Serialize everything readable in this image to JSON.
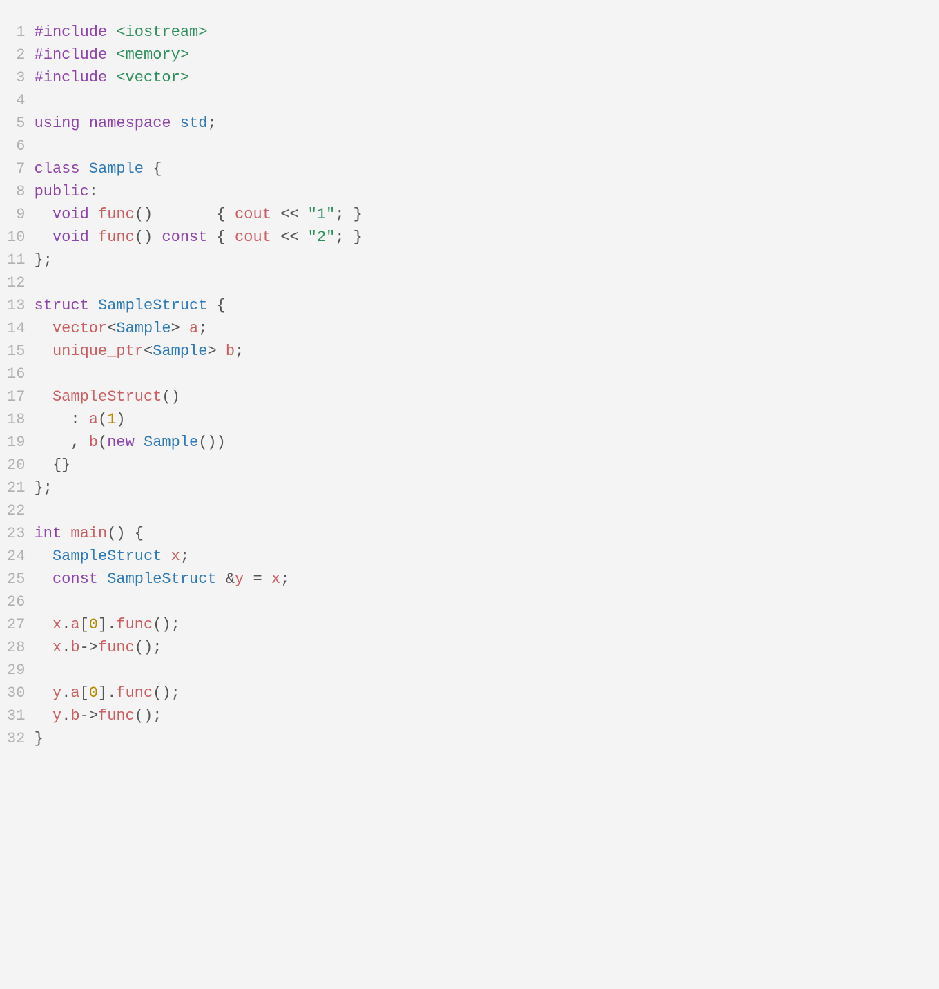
{
  "language": "cpp",
  "colors": {
    "background": "#f4f4f4",
    "gutter": "#b0b0b0",
    "keyword": "#8e44ad",
    "type": "#2e7ab8",
    "func": "#cc5e61",
    "string": "#2f8f5b",
    "number": "#b58900",
    "punct": "#555555",
    "default": "#333333"
  },
  "lines": [
    {
      "n": "1",
      "tokens": [
        {
          "c": "keyword",
          "t": "#include"
        },
        {
          "c": "default",
          "t": " "
        },
        {
          "c": "string",
          "t": "<iostream>"
        }
      ]
    },
    {
      "n": "2",
      "tokens": [
        {
          "c": "keyword",
          "t": "#include"
        },
        {
          "c": "default",
          "t": " "
        },
        {
          "c": "string",
          "t": "<memory>"
        }
      ]
    },
    {
      "n": "3",
      "tokens": [
        {
          "c": "keyword",
          "t": "#include"
        },
        {
          "c": "default",
          "t": " "
        },
        {
          "c": "string",
          "t": "<vector>"
        }
      ]
    },
    {
      "n": "4",
      "tokens": []
    },
    {
      "n": "5",
      "tokens": [
        {
          "c": "keyword",
          "t": "using"
        },
        {
          "c": "default",
          "t": " "
        },
        {
          "c": "keyword",
          "t": "namespace"
        },
        {
          "c": "default",
          "t": " "
        },
        {
          "c": "type",
          "t": "std"
        },
        {
          "c": "punct",
          "t": ";"
        }
      ]
    },
    {
      "n": "6",
      "tokens": []
    },
    {
      "n": "7",
      "tokens": [
        {
          "c": "keyword",
          "t": "class"
        },
        {
          "c": "default",
          "t": " "
        },
        {
          "c": "type",
          "t": "Sample"
        },
        {
          "c": "default",
          "t": " "
        },
        {
          "c": "punct",
          "t": "{"
        }
      ]
    },
    {
      "n": "8",
      "tokens": [
        {
          "c": "keyword",
          "t": "public"
        },
        {
          "c": "punct",
          "t": ":"
        }
      ]
    },
    {
      "n": "9",
      "tokens": [
        {
          "c": "default",
          "t": "  "
        },
        {
          "c": "keyword",
          "t": "void"
        },
        {
          "c": "default",
          "t": " "
        },
        {
          "c": "func",
          "t": "func"
        },
        {
          "c": "punct",
          "t": "()       { "
        },
        {
          "c": "ident",
          "t": "cout"
        },
        {
          "c": "default",
          "t": " "
        },
        {
          "c": "punct",
          "t": "<<"
        },
        {
          "c": "default",
          "t": " "
        },
        {
          "c": "string",
          "t": "\"1\""
        },
        {
          "c": "punct",
          "t": "; }"
        }
      ]
    },
    {
      "n": "10",
      "tokens": [
        {
          "c": "default",
          "t": "  "
        },
        {
          "c": "keyword",
          "t": "void"
        },
        {
          "c": "default",
          "t": " "
        },
        {
          "c": "func",
          "t": "func"
        },
        {
          "c": "punct",
          "t": "() "
        },
        {
          "c": "keyword",
          "t": "const"
        },
        {
          "c": "punct",
          "t": " { "
        },
        {
          "c": "ident",
          "t": "cout"
        },
        {
          "c": "default",
          "t": " "
        },
        {
          "c": "punct",
          "t": "<<"
        },
        {
          "c": "default",
          "t": " "
        },
        {
          "c": "string",
          "t": "\"2\""
        },
        {
          "c": "punct",
          "t": "; }"
        }
      ]
    },
    {
      "n": "11",
      "tokens": [
        {
          "c": "punct",
          "t": "};"
        }
      ]
    },
    {
      "n": "12",
      "tokens": []
    },
    {
      "n": "13",
      "tokens": [
        {
          "c": "keyword",
          "t": "struct"
        },
        {
          "c": "default",
          "t": " "
        },
        {
          "c": "type",
          "t": "SampleStruct"
        },
        {
          "c": "default",
          "t": " "
        },
        {
          "c": "punct",
          "t": "{"
        }
      ]
    },
    {
      "n": "14",
      "tokens": [
        {
          "c": "default",
          "t": "  "
        },
        {
          "c": "ident",
          "t": "vector"
        },
        {
          "c": "punct",
          "t": "<"
        },
        {
          "c": "type",
          "t": "Sample"
        },
        {
          "c": "punct",
          "t": ">"
        },
        {
          "c": "default",
          "t": " "
        },
        {
          "c": "ident",
          "t": "a"
        },
        {
          "c": "punct",
          "t": ";"
        }
      ]
    },
    {
      "n": "15",
      "tokens": [
        {
          "c": "default",
          "t": "  "
        },
        {
          "c": "ident",
          "t": "unique_ptr"
        },
        {
          "c": "punct",
          "t": "<"
        },
        {
          "c": "type",
          "t": "Sample"
        },
        {
          "c": "punct",
          "t": ">"
        },
        {
          "c": "default",
          "t": " "
        },
        {
          "c": "ident",
          "t": "b"
        },
        {
          "c": "punct",
          "t": ";"
        }
      ]
    },
    {
      "n": "16",
      "tokens": []
    },
    {
      "n": "17",
      "tokens": [
        {
          "c": "default",
          "t": "  "
        },
        {
          "c": "func",
          "t": "SampleStruct"
        },
        {
          "c": "punct",
          "t": "()"
        }
      ]
    },
    {
      "n": "18",
      "tokens": [
        {
          "c": "default",
          "t": "    "
        },
        {
          "c": "punct",
          "t": ": "
        },
        {
          "c": "func",
          "t": "a"
        },
        {
          "c": "punct",
          "t": "("
        },
        {
          "c": "number",
          "t": "1"
        },
        {
          "c": "punct",
          "t": ")"
        }
      ]
    },
    {
      "n": "19",
      "tokens": [
        {
          "c": "default",
          "t": "    "
        },
        {
          "c": "punct",
          "t": ", "
        },
        {
          "c": "func",
          "t": "b"
        },
        {
          "c": "punct",
          "t": "("
        },
        {
          "c": "keyword",
          "t": "new"
        },
        {
          "c": "default",
          "t": " "
        },
        {
          "c": "type",
          "t": "Sample"
        },
        {
          "c": "punct",
          "t": "())"
        }
      ]
    },
    {
      "n": "20",
      "tokens": [
        {
          "c": "default",
          "t": "  "
        },
        {
          "c": "punct",
          "t": "{}"
        }
      ]
    },
    {
      "n": "21",
      "tokens": [
        {
          "c": "punct",
          "t": "};"
        }
      ]
    },
    {
      "n": "22",
      "tokens": []
    },
    {
      "n": "23",
      "tokens": [
        {
          "c": "keyword",
          "t": "int"
        },
        {
          "c": "default",
          "t": " "
        },
        {
          "c": "func",
          "t": "main"
        },
        {
          "c": "punct",
          "t": "() {"
        }
      ]
    },
    {
      "n": "24",
      "tokens": [
        {
          "c": "default",
          "t": "  "
        },
        {
          "c": "type",
          "t": "SampleStruct"
        },
        {
          "c": "default",
          "t": " "
        },
        {
          "c": "ident",
          "t": "x"
        },
        {
          "c": "punct",
          "t": ";"
        }
      ]
    },
    {
      "n": "25",
      "tokens": [
        {
          "c": "default",
          "t": "  "
        },
        {
          "c": "keyword",
          "t": "const"
        },
        {
          "c": "default",
          "t": " "
        },
        {
          "c": "type",
          "t": "SampleStruct"
        },
        {
          "c": "default",
          "t": " "
        },
        {
          "c": "punct",
          "t": "&"
        },
        {
          "c": "ident",
          "t": "y"
        },
        {
          "c": "default",
          "t": " "
        },
        {
          "c": "punct",
          "t": "="
        },
        {
          "c": "default",
          "t": " "
        },
        {
          "c": "ident",
          "t": "x"
        },
        {
          "c": "punct",
          "t": ";"
        }
      ]
    },
    {
      "n": "26",
      "tokens": []
    },
    {
      "n": "27",
      "tokens": [
        {
          "c": "default",
          "t": "  "
        },
        {
          "c": "ident",
          "t": "x"
        },
        {
          "c": "punct",
          "t": "."
        },
        {
          "c": "ident",
          "t": "a"
        },
        {
          "c": "punct",
          "t": "["
        },
        {
          "c": "number",
          "t": "0"
        },
        {
          "c": "punct",
          "t": "]."
        },
        {
          "c": "func",
          "t": "func"
        },
        {
          "c": "punct",
          "t": "();"
        }
      ]
    },
    {
      "n": "28",
      "tokens": [
        {
          "c": "default",
          "t": "  "
        },
        {
          "c": "ident",
          "t": "x"
        },
        {
          "c": "punct",
          "t": "."
        },
        {
          "c": "ident",
          "t": "b"
        },
        {
          "c": "punct",
          "t": "->"
        },
        {
          "c": "func",
          "t": "func"
        },
        {
          "c": "punct",
          "t": "();"
        }
      ]
    },
    {
      "n": "29",
      "tokens": []
    },
    {
      "n": "30",
      "tokens": [
        {
          "c": "default",
          "t": "  "
        },
        {
          "c": "ident",
          "t": "y"
        },
        {
          "c": "punct",
          "t": "."
        },
        {
          "c": "ident",
          "t": "a"
        },
        {
          "c": "punct",
          "t": "["
        },
        {
          "c": "number",
          "t": "0"
        },
        {
          "c": "punct",
          "t": "]."
        },
        {
          "c": "func",
          "t": "func"
        },
        {
          "c": "punct",
          "t": "();"
        }
      ]
    },
    {
      "n": "31",
      "tokens": [
        {
          "c": "default",
          "t": "  "
        },
        {
          "c": "ident",
          "t": "y"
        },
        {
          "c": "punct",
          "t": "."
        },
        {
          "c": "ident",
          "t": "b"
        },
        {
          "c": "punct",
          "t": "->"
        },
        {
          "c": "func",
          "t": "func"
        },
        {
          "c": "punct",
          "t": "();"
        }
      ]
    },
    {
      "n": "32",
      "tokens": [
        {
          "c": "punct",
          "t": "}"
        }
      ]
    }
  ]
}
